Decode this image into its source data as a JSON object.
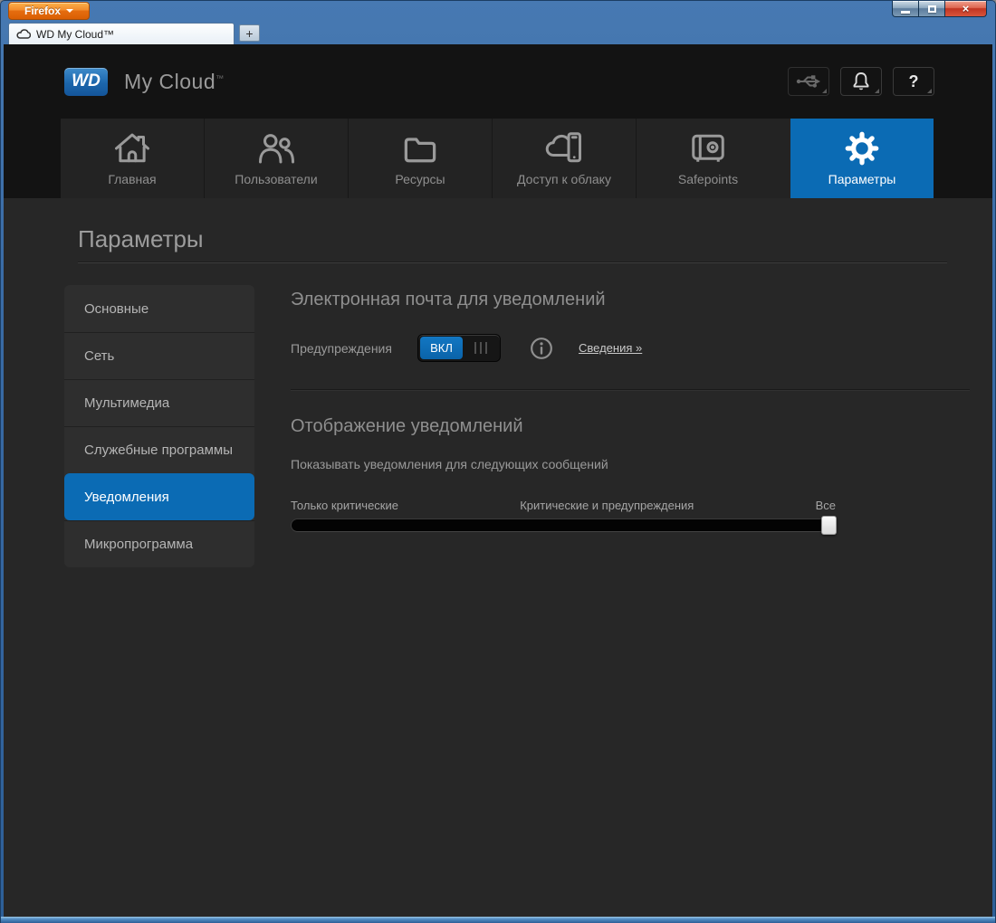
{
  "browser": {
    "firefox_button": "Firefox",
    "tab_title": "WD My Cloud™",
    "new_tab_label": "+",
    "window_controls": {
      "close_glyph": "×"
    }
  },
  "header": {
    "logo_text": "WD",
    "product": "My Cloud",
    "trademark": "™",
    "help_glyph": "?"
  },
  "nav": {
    "tabs": [
      {
        "label": "Главная",
        "icon": "home-icon",
        "active": false
      },
      {
        "label": "Пользователи",
        "icon": "users-icon",
        "active": false
      },
      {
        "label": "Ресурсы",
        "icon": "folder-icon",
        "active": false
      },
      {
        "label": "Доступ к облаку",
        "icon": "cloud-access-icon",
        "active": false
      },
      {
        "label": "Safepoints",
        "icon": "safe-icon",
        "active": false
      },
      {
        "label": "Параметры",
        "icon": "gear-icon",
        "active": true
      }
    ]
  },
  "page": {
    "title": "Параметры"
  },
  "sidebar": {
    "items": [
      {
        "label": "Основные",
        "active": false
      },
      {
        "label": "Сеть",
        "active": false
      },
      {
        "label": "Мультимедиа",
        "active": false
      },
      {
        "label": "Служебные программы",
        "active": false
      },
      {
        "label": "Уведомления",
        "active": true
      },
      {
        "label": "Микропрограмма",
        "active": false
      }
    ]
  },
  "content": {
    "email_section": {
      "heading": "Электронная почта для уведомлений",
      "toggle_label": "Предупреждения",
      "toggle_state": "ВКЛ",
      "details_link": "Сведения »"
    },
    "display_section": {
      "heading": "Отображение уведомлений",
      "description": "Показывать уведомления для следующих сообщений",
      "slider_labels": [
        "Только критические",
        "Критические и предупреждения",
        "Все"
      ],
      "slider_value": "Все"
    }
  },
  "colors": {
    "accent_blue": "#0b6bb4",
    "titlebar_blue": "#3a6ca6",
    "firefox_orange": "#e56d10",
    "header_bg": "#131313",
    "navbar_bg": "#232323",
    "page_bg": "#272727",
    "sidebar_bg": "#2e2e2e"
  }
}
